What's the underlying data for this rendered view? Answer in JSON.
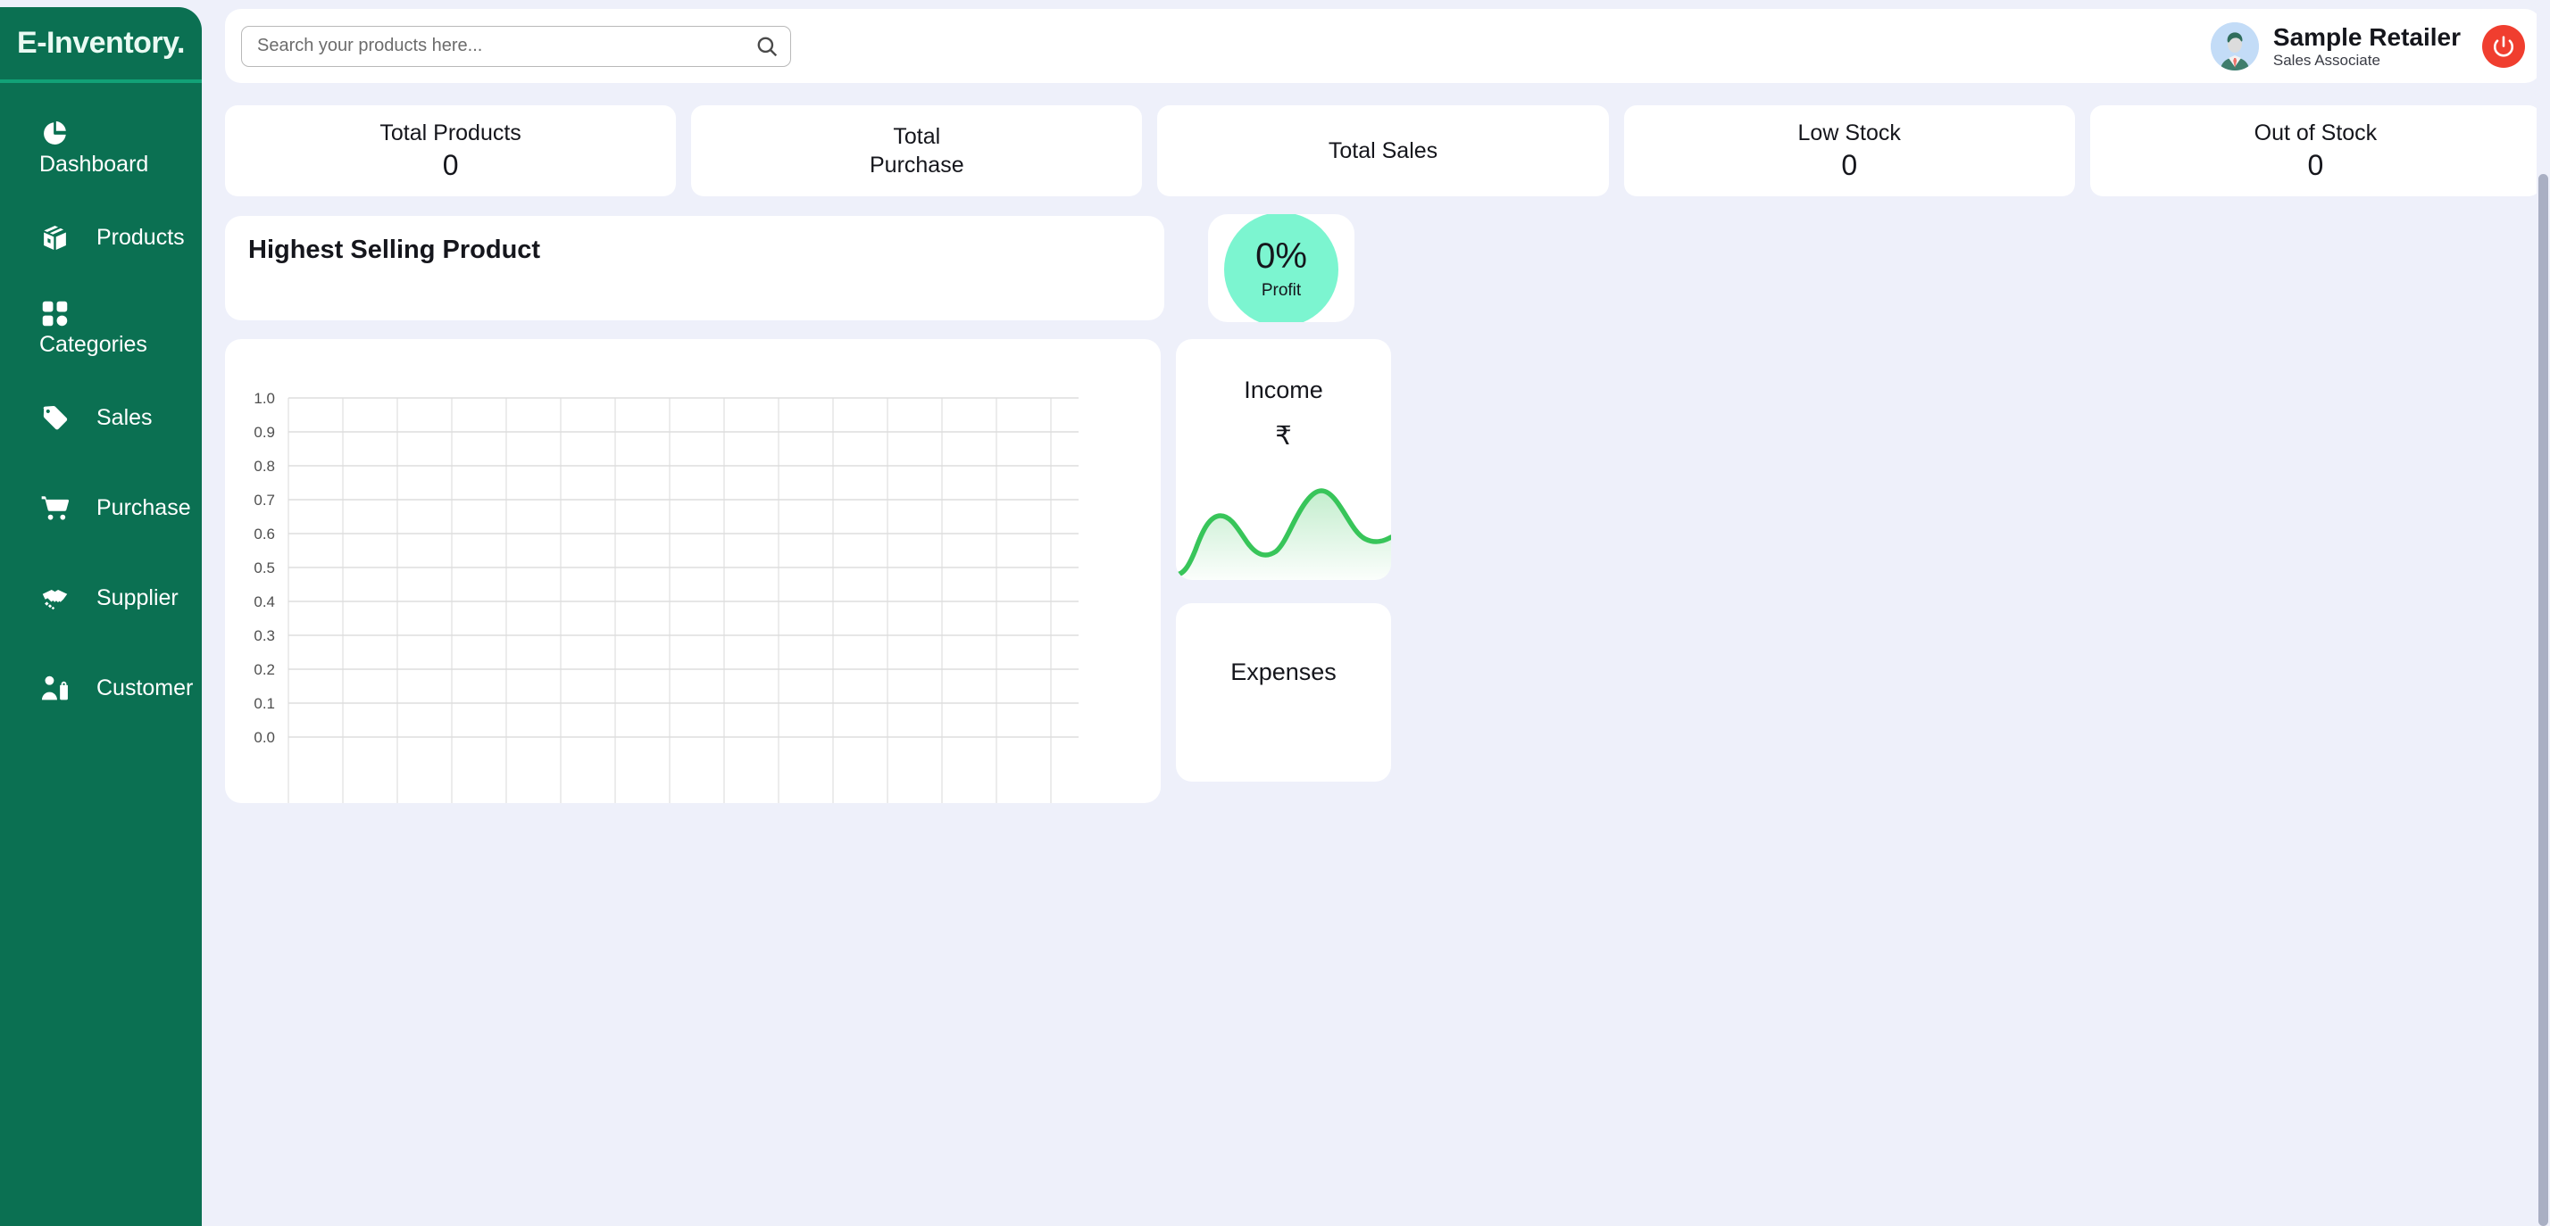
{
  "brand": {
    "title": "E-Inventory."
  },
  "sidebar": {
    "items": [
      {
        "label": "Dashboard",
        "icon": "pie-chart-icon",
        "layout": "stacked"
      },
      {
        "label": "Products",
        "icon": "box-icon",
        "layout": "inline"
      },
      {
        "label": "Categories",
        "icon": "grid-icon",
        "layout": "stacked"
      },
      {
        "label": "Sales",
        "icon": "tag-icon",
        "layout": "inline"
      },
      {
        "label": "Purchase",
        "icon": "cart-icon",
        "layout": "inline"
      },
      {
        "label": "Supplier",
        "icon": "handshake-icon",
        "layout": "inline"
      },
      {
        "label": "Customer",
        "icon": "customer-icon",
        "layout": "inline"
      }
    ]
  },
  "search": {
    "placeholder": "Search your products here...",
    "value": ""
  },
  "profile": {
    "name": "Sample Retailer",
    "role": "Sales Associate",
    "logout_icon": "power-icon"
  },
  "stats": [
    {
      "label": "Total Products",
      "value": "0"
    },
    {
      "label": "Total Purchase",
      "value": ""
    },
    {
      "label": "Total Sales",
      "value": ""
    },
    {
      "label": "Low Stock",
      "value": "0"
    },
    {
      "label": "Out of Stock",
      "value": "0"
    }
  ],
  "highest_selling": {
    "title": "Highest Selling Product"
  },
  "profit": {
    "percent": "0%",
    "label": "Profit",
    "circle_color": "#7cf5d0"
  },
  "income": {
    "title": "Income",
    "amount": "₹",
    "line_color": "#38c55a"
  },
  "expenses": {
    "title": "Expenses"
  },
  "chart_data": {
    "type": "line",
    "title": "",
    "xlabel": "",
    "ylabel": "",
    "x": [],
    "series": [],
    "ylim": [
      0.0,
      1.0
    ],
    "xlim": [
      0,
      1
    ],
    "yticks": [
      "1.0",
      "0.9",
      "0.8",
      "0.7",
      "0.6",
      "0.5",
      "0.4",
      "0.3",
      "0.2",
      "0.1",
      "0.0"
    ],
    "xticks": [],
    "grid": true,
    "legend": "none",
    "gridline_color": "#d9d9d9",
    "note": "empty plot: axes rendered with no data series"
  },
  "theme": {
    "page_bg": "#eef0fa",
    "sidebar_bg": "#0b7052",
    "sidebar_divider": "#12a277",
    "card_bg": "#ffffff",
    "accent_red": "#f03e2f",
    "accent_green": "#38c55a",
    "text_dark": "#15161c"
  }
}
